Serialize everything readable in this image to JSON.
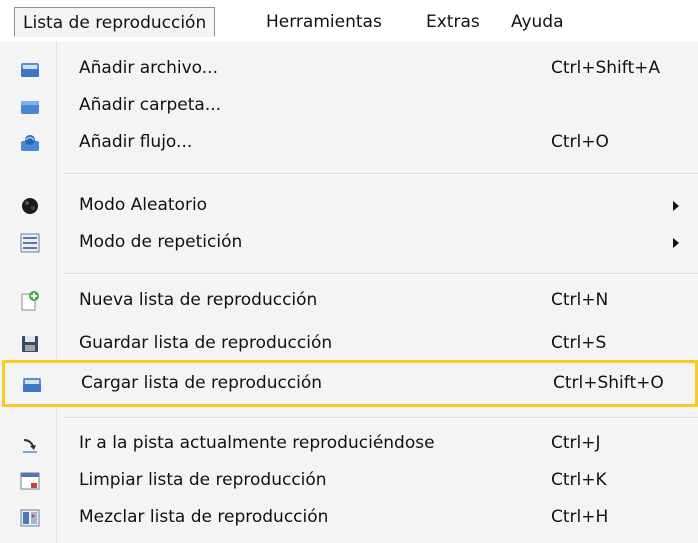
{
  "menubar": {
    "items": [
      {
        "label": "Lista de reproducción"
      },
      {
        "label": "Herramientas"
      },
      {
        "label": "Extras"
      },
      {
        "label": "Ayuda"
      }
    ]
  },
  "menu": {
    "items": [
      {
        "label": "Añadir archivo...",
        "shortcut": "Ctrl+Shift+A",
        "icon": "folder-open-icon"
      },
      {
        "label": "Añadir carpeta...",
        "shortcut": "",
        "icon": "folder-icon"
      },
      {
        "label": "Añadir flujo...",
        "shortcut": "Ctrl+O",
        "icon": "network-folder-icon"
      },
      {
        "label": "Modo Aleatorio",
        "shortcut": "",
        "icon": "shuffle-icon",
        "submenu": true
      },
      {
        "label": "Modo de repetición",
        "shortcut": "",
        "icon": "repeat-list-icon",
        "submenu": true
      },
      {
        "label": "Nueva lista de reproducción",
        "shortcut": "Ctrl+N",
        "icon": "new-document-icon"
      },
      {
        "label": "Guardar lista de reproducción",
        "shortcut": "Ctrl+S",
        "icon": "floppy-disk-icon"
      },
      {
        "label": "Cargar lista de reproducción",
        "shortcut": "Ctrl+Shift+O",
        "icon": "folder-open-icon",
        "highlighted": true
      },
      {
        "label": "Ir a la pista actualmente reproduciéndose",
        "shortcut": "Ctrl+J",
        "icon": "jump-arrow-icon"
      },
      {
        "label": "Limpiar lista de reproducción",
        "shortcut": "Ctrl+K",
        "icon": "clear-list-icon"
      },
      {
        "label": "Mezclar lista de reproducción",
        "shortcut": "Ctrl+H",
        "icon": "shuffle-list-icon"
      }
    ]
  },
  "colors": {
    "menu_background": "#f4f4f4",
    "highlight_border": "#ffc81e",
    "separator": "#dadada"
  }
}
